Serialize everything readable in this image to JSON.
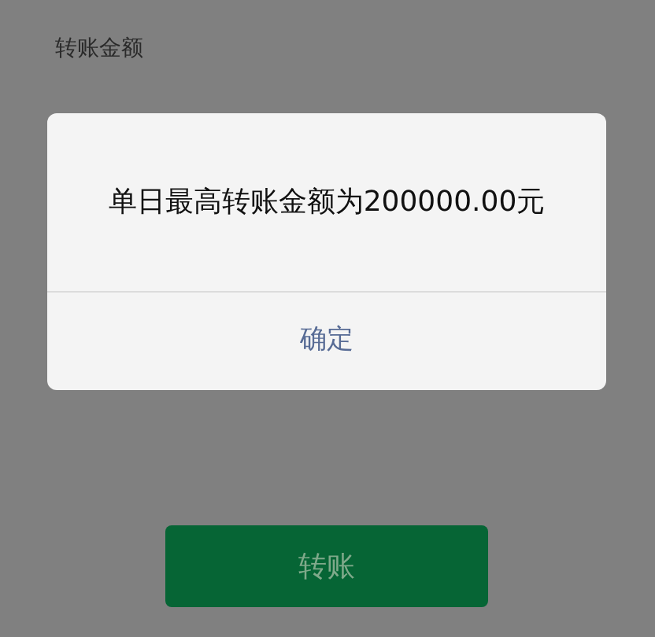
{
  "page": {
    "amount_label": "转账金额"
  },
  "dialog": {
    "message": "单日最高转账金额为200000.00元",
    "confirm": "确定"
  },
  "transfer_button": {
    "label": "转账",
    "disabled": true
  }
}
